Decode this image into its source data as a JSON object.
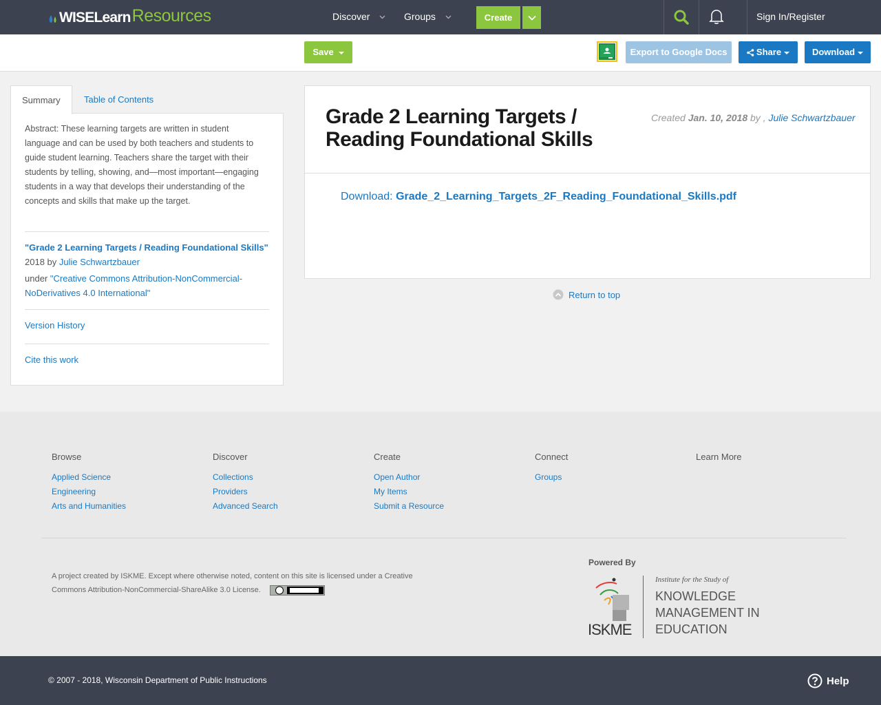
{
  "nav": {
    "logo_wise": "WISELearn",
    "logo_resources": "Resources",
    "discover": "Discover",
    "groups": "Groups",
    "create": "Create",
    "signin": "Sign In/Register"
  },
  "toolbar": {
    "save": "Save",
    "export": "Export to Google Docs",
    "share": "Share",
    "download": "Download"
  },
  "tabs": {
    "summary": "Summary",
    "toc": "Table of Contents"
  },
  "summary": {
    "abstract": "Abstract: These learning targets are written in student language and can be used by both teachers and students to guide student learning. Teachers share the target with their students by telling, showing, and—most important—engaging students in a way that develops their understanding of the concepts and skills that make up the target.",
    "work_title": "\"Grade 2 Learning Targets / Reading Foundational Skills\"",
    "year_by": "2018 by",
    "author": "Julie Schwartzbauer",
    "under": "under",
    "license": "\"Creative Commons Attribution-NonCommercial-NoDerivatives 4.0 International\"",
    "version_history": "Version History",
    "cite": "Cite this work"
  },
  "resource": {
    "title": "Grade 2 Learning Targets / Reading Foundational Skills",
    "created_label": "Created",
    "created_date": "Jan. 10, 2018",
    "by": "by ,",
    "author": "Julie Schwartzbauer",
    "download_label": "Download:",
    "download_file": "Grade_2_Learning_Targets_2F_Reading_Foundational_Skills.pdf",
    "return_top": "Return to top"
  },
  "footer": {
    "browse": {
      "heading": "Browse",
      "links": [
        "Applied Science",
        "Engineering",
        "Arts and Humanities"
      ]
    },
    "discover": {
      "heading": "Discover",
      "links": [
        "Collections",
        "Providers",
        "Advanced Search"
      ]
    },
    "create": {
      "heading": "Create",
      "links": [
        "Open Author",
        "My Items",
        "Submit a Resource"
      ]
    },
    "connect": {
      "heading": "Connect",
      "links": [
        "Groups"
      ]
    },
    "learn_more": {
      "heading": "Learn More"
    },
    "license_text": "A project created by ISKME. Except where otherwise noted, content on this site is licensed under a Creative Commons Attribution-NonCommercial-ShareAlike 3.0 License.",
    "powered_by": "Powered By",
    "iskme_tagline": "Institute for the Study of",
    "iskme_line1": "KNOWLEDGE",
    "iskme_line2": "MANAGEMENT IN",
    "iskme_line3": "EDUCATION",
    "iskme_abbr": "ISKME",
    "copyright": "© 2007 - 2018, Wisconsin Department of Public Instructions",
    "help": "Help"
  },
  "colors": {
    "navbar": "#3d4250",
    "green": "#8cc63f",
    "blue": "#1a79c2",
    "export_disabled": "#9ec4e4"
  }
}
